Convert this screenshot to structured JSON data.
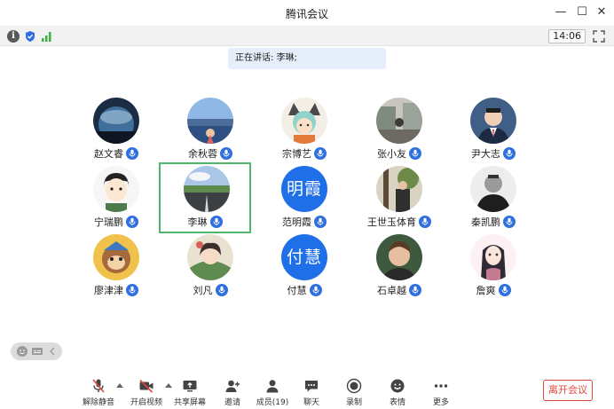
{
  "window": {
    "title": "腾讯会议",
    "minimize_glyph": "—",
    "maximize_glyph": "☐",
    "close_glyph": "✕"
  },
  "statusbar": {
    "info_glyph": "i",
    "time": "14:06",
    "icons": [
      "info-icon",
      "shield-icon",
      "signal-icon",
      "fullscreen-icon"
    ]
  },
  "speaking": {
    "text": "正在讲话: 李琳;"
  },
  "participants": [
    {
      "name": "赵文睿",
      "avatar": "earth-photo"
    },
    {
      "name": "余秋蓉",
      "avatar": "lake-photo"
    },
    {
      "name": "宗博艺",
      "avatar": "anime-photo"
    },
    {
      "name": "张小友",
      "avatar": "street-photo"
    },
    {
      "name": "尹大志",
      "avatar": "man-suit-photo"
    },
    {
      "name": "宁瑞鹏",
      "avatar": "cartoon-boy-photo"
    },
    {
      "name": "李琳",
      "avatar": "road-photo",
      "selected": true
    },
    {
      "name": "范明霞",
      "avatar": "text",
      "avatar_text": "明霞"
    },
    {
      "name": "王世玉体育",
      "avatar": "tree-photo"
    },
    {
      "name": "秦凯鹏",
      "avatar": "man-bw-photo"
    },
    {
      "name": "廖津津",
      "avatar": "cartoon-monkey-photo"
    },
    {
      "name": "刘凡",
      "avatar": "girl-art-photo"
    },
    {
      "name": "付慧",
      "avatar": "text",
      "avatar_text": "付慧"
    },
    {
      "name": "石卓越",
      "avatar": "actor-photo"
    },
    {
      "name": "詹爽",
      "avatar": "anime-girl-photo"
    }
  ],
  "toolbar": {
    "items": [
      {
        "label": "解除静音",
        "icon": "mic-muted-icon"
      },
      {
        "label": "开启视频",
        "icon": "camera-off-icon"
      },
      {
        "label": "共享屏幕",
        "icon": "share-screen-icon"
      },
      {
        "label": "邀请",
        "icon": "invite-icon"
      },
      {
        "label": "成员(19)",
        "icon": "members-icon"
      },
      {
        "label": "聊天",
        "icon": "chat-icon"
      },
      {
        "label": "录制",
        "icon": "record-icon"
      },
      {
        "label": "表情",
        "icon": "emoji-icon"
      },
      {
        "label": "更多",
        "icon": "more-icon"
      }
    ],
    "leave_label": "离开会议"
  },
  "colors": {
    "accent": "#2f6fdf",
    "selected_border": "#4fb56a",
    "leave": "#e0453b",
    "banner": "#e6eefb"
  }
}
